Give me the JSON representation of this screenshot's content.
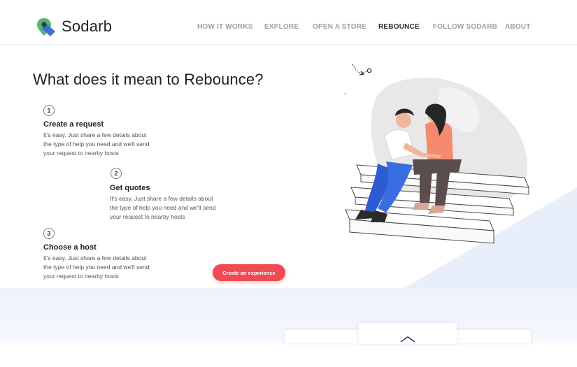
{
  "brand": {
    "name": "Sodarb"
  },
  "nav": [
    {
      "label": "HOW IT WORKS",
      "active": false
    },
    {
      "label": "EXPLORE",
      "active": false
    },
    {
      "label": "OPEN A STORE",
      "active": false
    },
    {
      "label": "REBOUNCE",
      "active": true
    },
    {
      "label": "FOLLOW SODARB",
      "active": false
    },
    {
      "label": "ABOUT",
      "active": false
    }
  ],
  "hero": {
    "title": "What does it mean to Rebounce?",
    "steps": [
      {
        "number": "1",
        "title": "Create a request",
        "description": "It's easy. Just share a few details about the type of help you need and we'll send your request to nearby hosts"
      },
      {
        "number": "2",
        "title": "Get quotes",
        "description": "It's easy. Just share a few details about the type of help you need and we'll send your request to nearby hosts"
      },
      {
        "number": "3",
        "title": "Choose a host",
        "description": "It's easy. Just share a few details about the type of help you need and we'll send your request to nearby hosts"
      }
    ],
    "cta_label": "Create an experience"
  },
  "colors": {
    "accent": "#f04a53",
    "nav_inactive": "#9aa0a6",
    "logo_green": "#5cb85c",
    "logo_blue": "#3b6fd6",
    "band": "#eef2fb"
  },
  "icons": {
    "logo": "map-pin-logo-icon",
    "scroll_up": "chevron-up-icon"
  }
}
